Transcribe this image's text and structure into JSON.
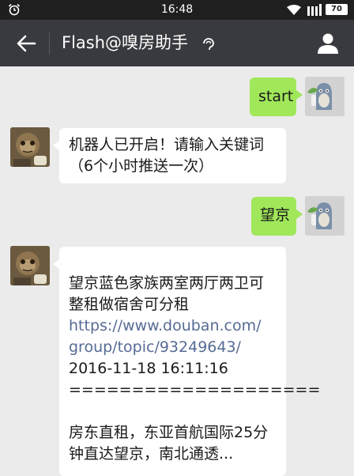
{
  "status_bar": {
    "time": "16:48",
    "battery": "70",
    "icons": [
      "alarm-icon",
      "wifi-icon",
      "signal-icon",
      "battery-icon"
    ]
  },
  "header": {
    "title": "Flash@嗅房助手",
    "icons": [
      "back-arrow-icon",
      "earpiece-icon",
      "profile-icon"
    ],
    "background": "#393a3f"
  },
  "chat": {
    "colors": {
      "background": "#ebebeb",
      "outgoing_bubble": "#a0e75a",
      "incoming_bubble": "#ffffff",
      "link": "#576b95"
    },
    "messages": [
      {
        "sender": "user",
        "text": "start"
      },
      {
        "sender": "bot",
        "lines": [
          "机器人已开启！请输入关键词",
          "（6个小时推送一次）"
        ]
      },
      {
        "sender": "user",
        "text": "望京"
      },
      {
        "sender": "bot",
        "title_lines": [
          "望京蓝色家族两室两厅两卫可",
          "整租做宿舍可分租"
        ],
        "link_lines": [
          "https://www.douban.com/",
          "group/topic/93249643/"
        ],
        "datetime": "2016-11-18 16:11:16",
        "separator": "====================",
        "desc_lines": [
          "房东直租，东亚首航国际25分",
          "钟直达望京，南北通透..."
        ]
      }
    ]
  }
}
